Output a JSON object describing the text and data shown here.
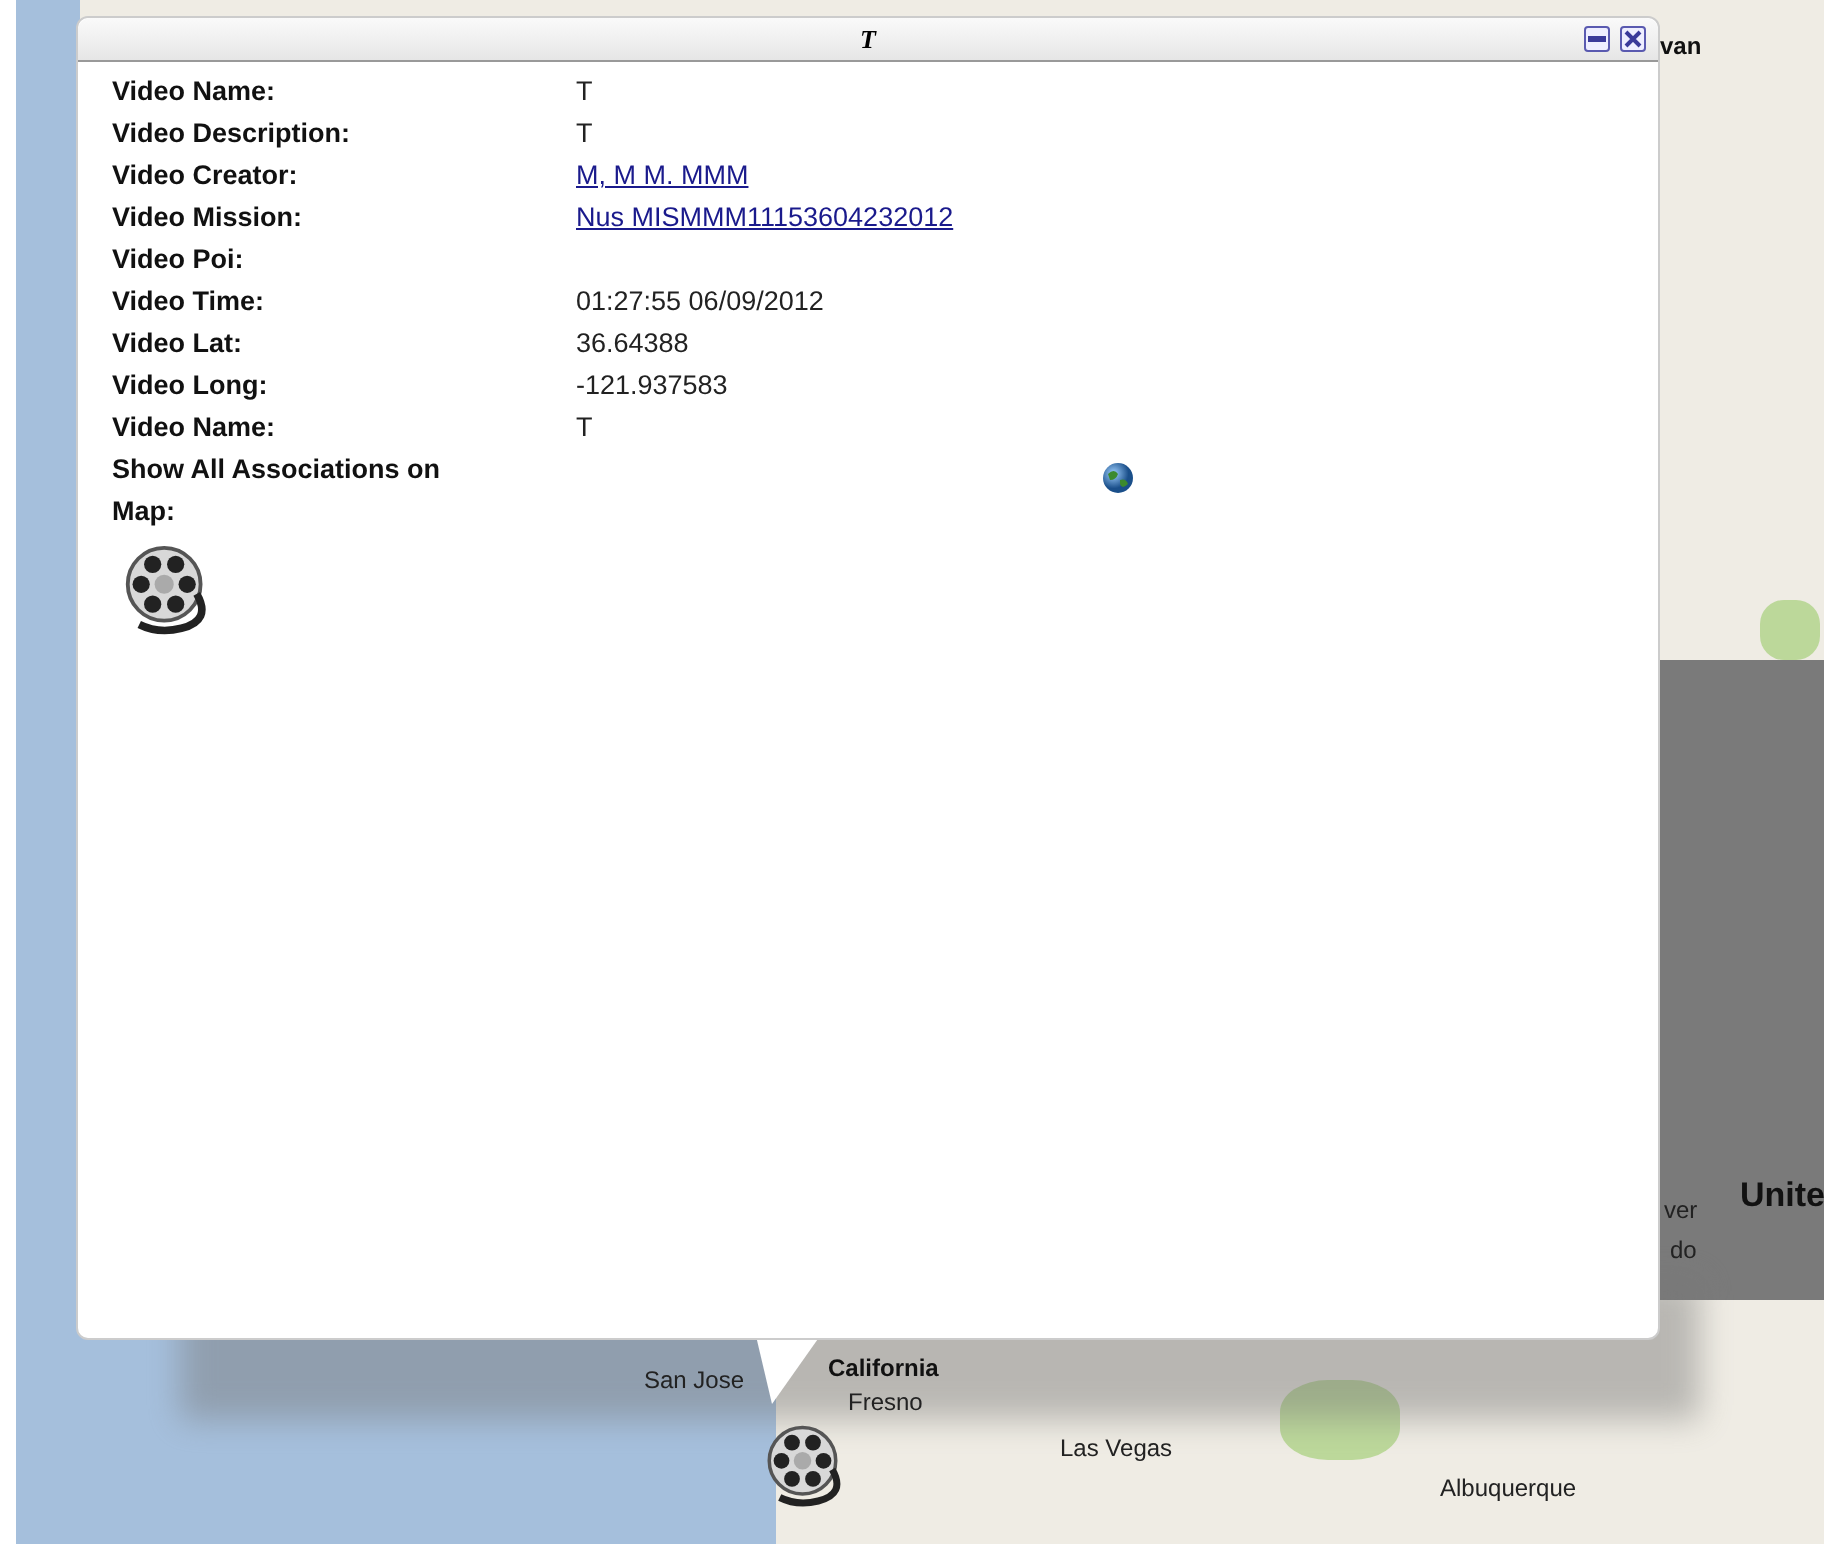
{
  "map": {
    "labels": [
      {
        "text": "van",
        "kind": "region"
      },
      {
        "text": "Unite",
        "kind": "country"
      },
      {
        "text": "ver",
        "kind": "city"
      },
      {
        "text": "do",
        "kind": "city"
      },
      {
        "text": "San Jose",
        "kind": "city"
      },
      {
        "text": "California",
        "kind": "region"
      },
      {
        "text": "Fresno",
        "kind": "city"
      },
      {
        "text": "Las Vegas",
        "kind": "city"
      },
      {
        "text": "Albuquerque",
        "kind": "city"
      }
    ]
  },
  "popup": {
    "title": "T",
    "fields": [
      {
        "label": "Video Name:",
        "value": "T",
        "kind": "text"
      },
      {
        "label": "Video Description:",
        "value": "T",
        "kind": "text"
      },
      {
        "label": "Video Creator:",
        "value": "M, M M. MMM",
        "kind": "link"
      },
      {
        "label": "Video Mission:",
        "value": "Nus MISMMM11153604232012",
        "kind": "link"
      },
      {
        "label": "Video Poi:",
        "kind": "text"
      },
      {
        "label": "Video Time:",
        "value": "01:27:55 06/09/2012",
        "kind": "text"
      },
      {
        "label": "Video Lat:",
        "value": "36.64388",
        "kind": "text"
      },
      {
        "label": "Video Long:",
        "value": "-121.937583",
        "kind": "text"
      },
      {
        "label": "Video Name:",
        "value": "T",
        "kind": "text"
      },
      {
        "label": "Show All Associations on Map:",
        "kind": "globe"
      }
    ]
  }
}
